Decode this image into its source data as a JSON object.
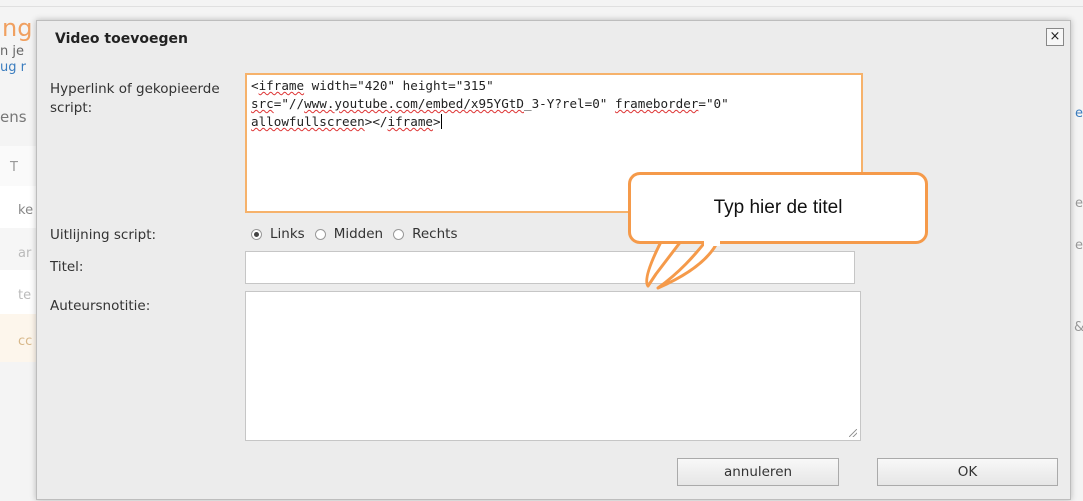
{
  "background": {
    "fragments": [
      "ng",
      "n je",
      "ug r",
      "ens",
      "T",
      "ke",
      "ar",
      "te",
      "cc",
      "e",
      "e",
      "e",
      "&"
    ]
  },
  "dialog": {
    "title": "Video toevoegen",
    "close_glyph": "×",
    "fields": {
      "script_label": "Hyperlink of gekopieerde script:",
      "script_value": {
        "line1_part1": "<",
        "line1_iframe": "iframe",
        "line1_rest": " width=\"420\" height=\"315\"",
        "line2_src": "src",
        "line2_mid": "=\"//",
        "line2_url": "www.youtube.com/embed/x95YGtD",
        "line2_end": "_3-Y?rel=0\" ",
        "line2_fb": "frameborder",
        "line2_tail": "=\"0\"",
        "line3_allow": "allowfullscreen",
        "line3_mid": "></",
        "line3_iframe": "iframe",
        "line3_end": ">"
      },
      "alignment_label": "Uitlijning script:",
      "alignment_options": [
        "Links",
        "Midden",
        "Rechts"
      ],
      "alignment_selected": "Links",
      "title_label": "Titel:",
      "title_value": "",
      "note_label": "Auteursnotitie:",
      "note_value": ""
    },
    "buttons": {
      "cancel": "annuleren",
      "ok": "OK"
    }
  },
  "callout": {
    "text": "Typ hier de titel",
    "border_color": "#f59a4a"
  }
}
